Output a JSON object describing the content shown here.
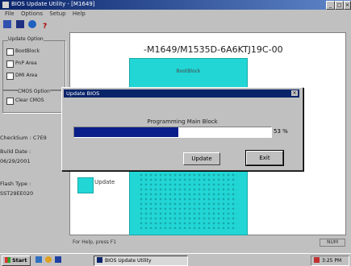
{
  "window": {
    "title": "BIOS Update Utility - [M1649]"
  },
  "menu": [
    "File",
    "Options",
    "Setup",
    "Help"
  ],
  "left": {
    "update_options_title": "Update Option",
    "opt1": "BootBlock",
    "opt2": "PnP Area",
    "opt3": "DMI Area",
    "cmos_title": "CMOS Option",
    "cmos_opt": "Clear CMOS",
    "checksum": "CheckSum : C7E9",
    "build_date_label": "Build Date :",
    "build_date": "06/29/2001",
    "flash_type_label": "Flash Type :",
    "flash_type": "SST29EE020"
  },
  "chip": {
    "code": "-M1649/M1535D-6A6KTJ19C-00",
    "label": "BootBlock"
  },
  "legend": {
    "label": "Update"
  },
  "dialog": {
    "title": "Update BIOS",
    "status": "Programming Main Block",
    "progress": 53,
    "progress_text": "53 %",
    "update_label": "Update",
    "exit_label": "Exit"
  },
  "status": {
    "text": "For Help, press F1",
    "right": "NUM"
  },
  "taskbar": {
    "start": "Start",
    "task": "BIOS Update Utility",
    "clock": "3:25 PM"
  },
  "colors": {
    "chip": "#22d6d6",
    "progress": "#0a1e8a",
    "title": "#0a246a"
  }
}
